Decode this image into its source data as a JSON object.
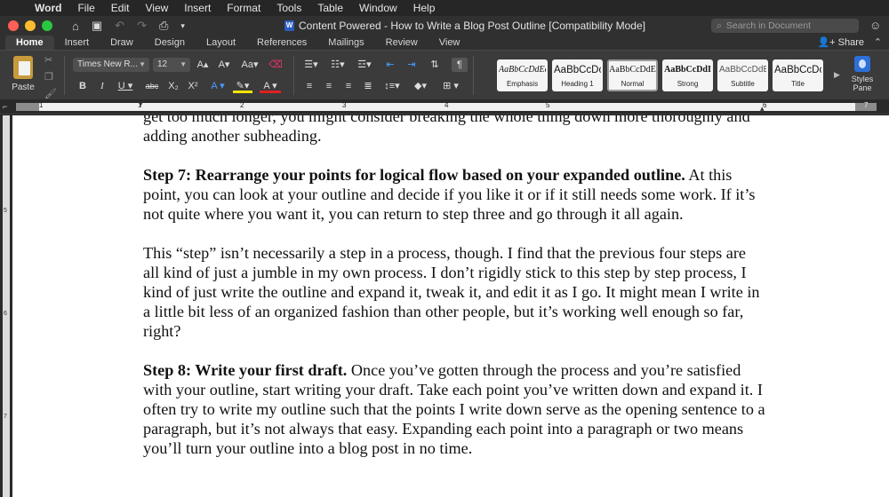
{
  "menubar": {
    "app_name": "Word",
    "items": [
      "File",
      "Edit",
      "View",
      "Insert",
      "Format",
      "Tools",
      "Table",
      "Window",
      "Help"
    ]
  },
  "titlebar": {
    "document_title": "Content Powered - How to Write a Blog Post Outline [Compatibility Mode]",
    "search_placeholder": "Search in Document"
  },
  "ribbon_tabs": {
    "items": [
      "Home",
      "Insert",
      "Draw",
      "Design",
      "Layout",
      "References",
      "Mailings",
      "Review",
      "View"
    ],
    "active": "Home",
    "share_label": "Share"
  },
  "ribbon": {
    "paste_label": "Paste",
    "font_name": "Times New R...",
    "font_size": "12",
    "styles": [
      {
        "sample": "AaBbCcDdEe",
        "name": "Emphasis"
      },
      {
        "sample": "AaBbCcDc",
        "name": "Heading 1"
      },
      {
        "sample": "AaBbCcDdE",
        "name": "Normal"
      },
      {
        "sample": "AaBbCcDdI",
        "name": "Strong"
      },
      {
        "sample": "AaBbCcDdEe",
        "name": "Subtitle"
      },
      {
        "sample": "AaBbCcDc",
        "name": "Title"
      }
    ],
    "selected_style": "Normal",
    "styles_pane_label": "Styles Pane"
  },
  "ruler": {
    "numbers": [
      "1",
      "1",
      "2",
      "3",
      "4",
      "5",
      "6",
      "7"
    ]
  },
  "vruler": {
    "numbers": [
      "5",
      "6",
      "7"
    ]
  },
  "document": {
    "paragraphs": [
      {
        "bold": "",
        "text": "get too much longer, you might consider breaking the whole thing down more thoroughly and adding another subheading."
      },
      {
        "bold": "Step 7: Rearrange your points for logical flow based on your expanded outline.",
        "text": "  At this point, you can look at your outline and decide if you like it or if it still needs some work.  If it’s not quite where you want it, you can return to step three and go through it all again."
      },
      {
        "bold": "",
        "text": "This “step” isn’t necessarily a step in a process, though.  I find that the previous four steps are all kind of just a jumble in my own process.  I don’t rigidly stick to this step by step process, I kind of just write the outline and expand it, tweak it, and edit it as I go.  It might mean I write in a little bit less of an organized fashion than other people, but it’s working well enough so far, right?"
      },
      {
        "bold": "Step 8: Write your first draft.",
        "text": "  Once you’ve gotten through the process and you’re satisfied with your outline, start writing your draft.  Take each point you’ve written down and expand it.  I often try to write my outline such that the points I write down serve as the opening sentence to a paragraph, but it’s not always that easy.  Expanding each point into a paragraph or two means you’ll turn your outline into a blog post in no time."
      }
    ]
  }
}
